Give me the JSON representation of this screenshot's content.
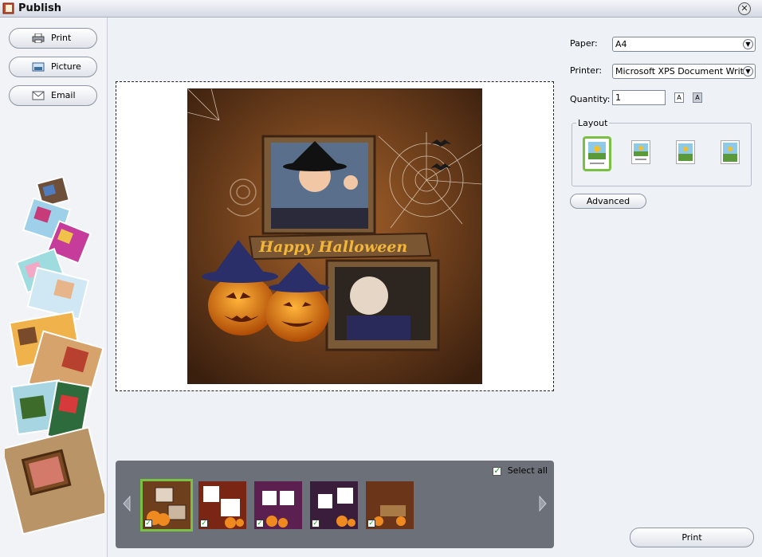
{
  "window": {
    "title": "Publish",
    "close_glyph": "✕"
  },
  "sidebar": {
    "buttons": [
      {
        "label": "Print",
        "icon": "printer-icon"
      },
      {
        "label": "Picture",
        "icon": "picture-icon"
      },
      {
        "label": "Email",
        "icon": "envelope-icon"
      }
    ]
  },
  "preview": {
    "card_title": "Happy Halloween"
  },
  "thumbnails": {
    "select_all_label": "Select all",
    "select_all_checked": true,
    "items": [
      {
        "selected": true,
        "checked": true
      },
      {
        "selected": false,
        "checked": true
      },
      {
        "selected": false,
        "checked": true
      },
      {
        "selected": false,
        "checked": true
      },
      {
        "selected": false,
        "checked": true
      }
    ]
  },
  "settings": {
    "paper_label": "Paper:",
    "paper_value": "A4",
    "printer_label": "Printer:",
    "printer_value": "Microsoft XPS Document Writer",
    "quantity_label": "Quantity:",
    "quantity_value": "1",
    "layout_label": "Layout",
    "layout_options": [
      "1 per page",
      "2 per page",
      "4 per page",
      "6 per page"
    ],
    "layout_selected_index": 0,
    "advanced_label": "Advanced",
    "print_label": "Print"
  },
  "colors": {
    "accent_green": "#7ac143",
    "strip_bg": "#6c7078"
  }
}
